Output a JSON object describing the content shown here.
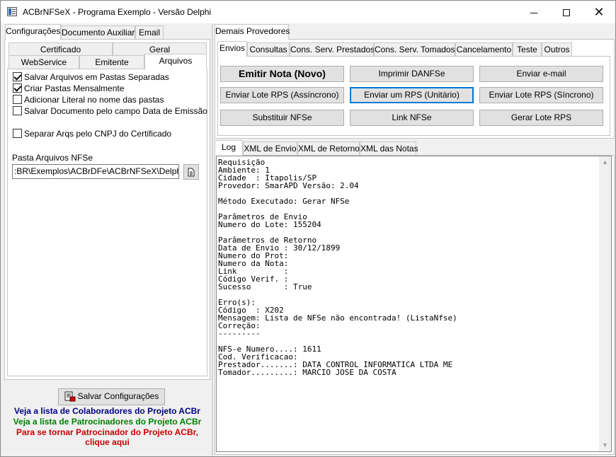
{
  "window": {
    "title": "ACBrNFSeX - Programa Exemplo - Versão Delphi",
    "minimize_label": "",
    "maximize_label": "",
    "close_label": "✕"
  },
  "left": {
    "top_tabs": [
      "Configurações",
      "Documento Auxiliar",
      "Email"
    ],
    "sub_tabs_row1": [
      "Certificado",
      "Geral"
    ],
    "sub_tabs_row2": [
      "WebService",
      "Emitente",
      "Arquivos"
    ],
    "checkboxes": [
      {
        "label": "Salvar Arquivos em Pastas Separadas",
        "checked": true
      },
      {
        "label": "Criar Pastas Mensalmente",
        "checked": true
      },
      {
        "label": "Adicionar Literal no nome das pastas",
        "checked": false
      },
      {
        "label": "Salvar Documento pelo campo Data de Emissão",
        "checked": false
      },
      {
        "label": "Separar Arqs pelo CNPJ do Certificado",
        "checked": false
      }
    ],
    "pasta_label": "Pasta Arquivos NFSe",
    "pasta_value": ":BR\\Exemplos\\ACBrDFe\\ACBrNFSeX\\Delphi\\Logs",
    "save_button": "Salvar Configurações",
    "link_colaboradores": "Veja a lista de Colaboradores do Projeto ACBr",
    "link_patrocinadores": "Veja a lista de Patrocinadores do Projeto ACBr",
    "link_patrocinador_1": "Para se tornar Patrocinador do Projeto ACBr,",
    "link_patrocinador_2": "clique aqui"
  },
  "right": {
    "provider_tab": "Demais Provedores",
    "op_tabs": [
      "Envios",
      "Consultas",
      "Cons. Serv. Prestados",
      "Cons. Serv. Tomados",
      "Cancelamento",
      "Teste",
      "Outros"
    ],
    "buttons": {
      "emitir_nota": "Emitir Nota (Novo)",
      "imprimir_danfse": "Imprimir DANFSe",
      "enviar_email": "Enviar e-mail",
      "enviar_lote_assincrono": "Enviar Lote RPS (Assíncrono)",
      "enviar_um_rps": "Enviar um RPS (Unitário)",
      "enviar_lote_sincrono": "Enviar Lote RPS (Síncrono)",
      "substituir_nfse": "Substituir NFSe",
      "link_nfse": "Link NFSe",
      "gerar_lote_rps": "Gerar Lote RPS"
    },
    "log_tabs": [
      "Log",
      "XML de Envio",
      "XML de Retorno",
      "XML das Notas"
    ],
    "log_text": "Requisição\nAmbiente: 1\nCidade  : Itapolis/SP\nProvedor: SmarAPD Versão: 2.04\n\nMétodo Executado: Gerar NFSe\n\nParâmetros de Envio\nNumero do Lote: 155204\n\nParâmetros de Retorno\nData de Envio : 30/12/1899\nNumero do Prot:\nNumero da Nota:\nLink          :\nCódigo Verif. :\nSucesso       : True\n\nErro(s):\nCódigo  : X202\nMensagem: Lista de NFSe não encontrada! (ListaNfse)\nCorreção:\n---------\n\nNFS-e Numero....: 1611\nCod. Verificacao:\nPrestador.......: DATA CONTROL INFORMATICA LTDA ME\nTomador.........: MARCIO JOSE DA COSTA"
  },
  "colors": {
    "link_blue": "#000080",
    "link_green": "#008000",
    "link_red": "#cc0000",
    "focus_border": "#0078d7"
  }
}
